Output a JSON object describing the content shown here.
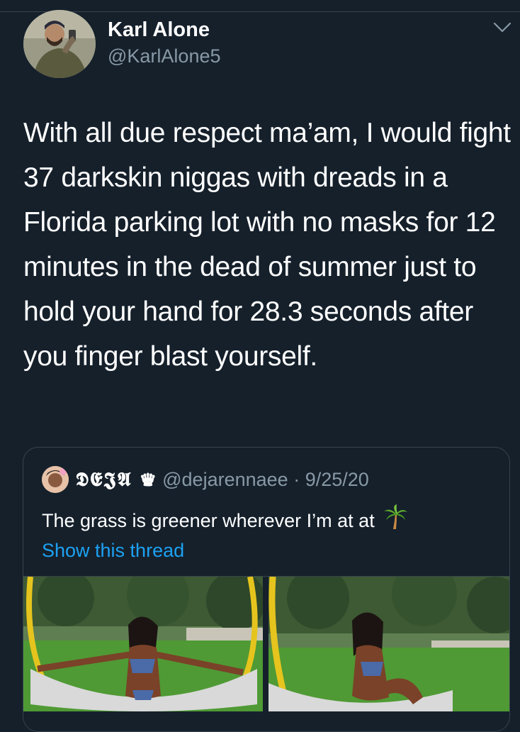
{
  "tweet": {
    "display_name": "Karl Alone",
    "handle": "@KarlAlone5",
    "text": "With all due respect ma’am, I would fight 37 darkskin niggas with dreads in a Florida parking lot with no masks for 12 minutes in the dead of summer just to hold your hand for 28.3 seconds after you finger blast yourself."
  },
  "quoted": {
    "name": "𝕯𝕰𝕵𝕬 ♛",
    "handle": "@dejarennaee",
    "separator": "·",
    "date": "9/25/20",
    "text": "The grass is greener wherever I’m at at",
    "show_thread": "Show this thread"
  },
  "colors": {
    "background": "#15202b",
    "secondary_text": "#8899a6",
    "link": "#1da1f2",
    "border": "#38444d"
  },
  "icons": [
    "chevron-down-icon",
    "palm-tree-icon"
  ]
}
